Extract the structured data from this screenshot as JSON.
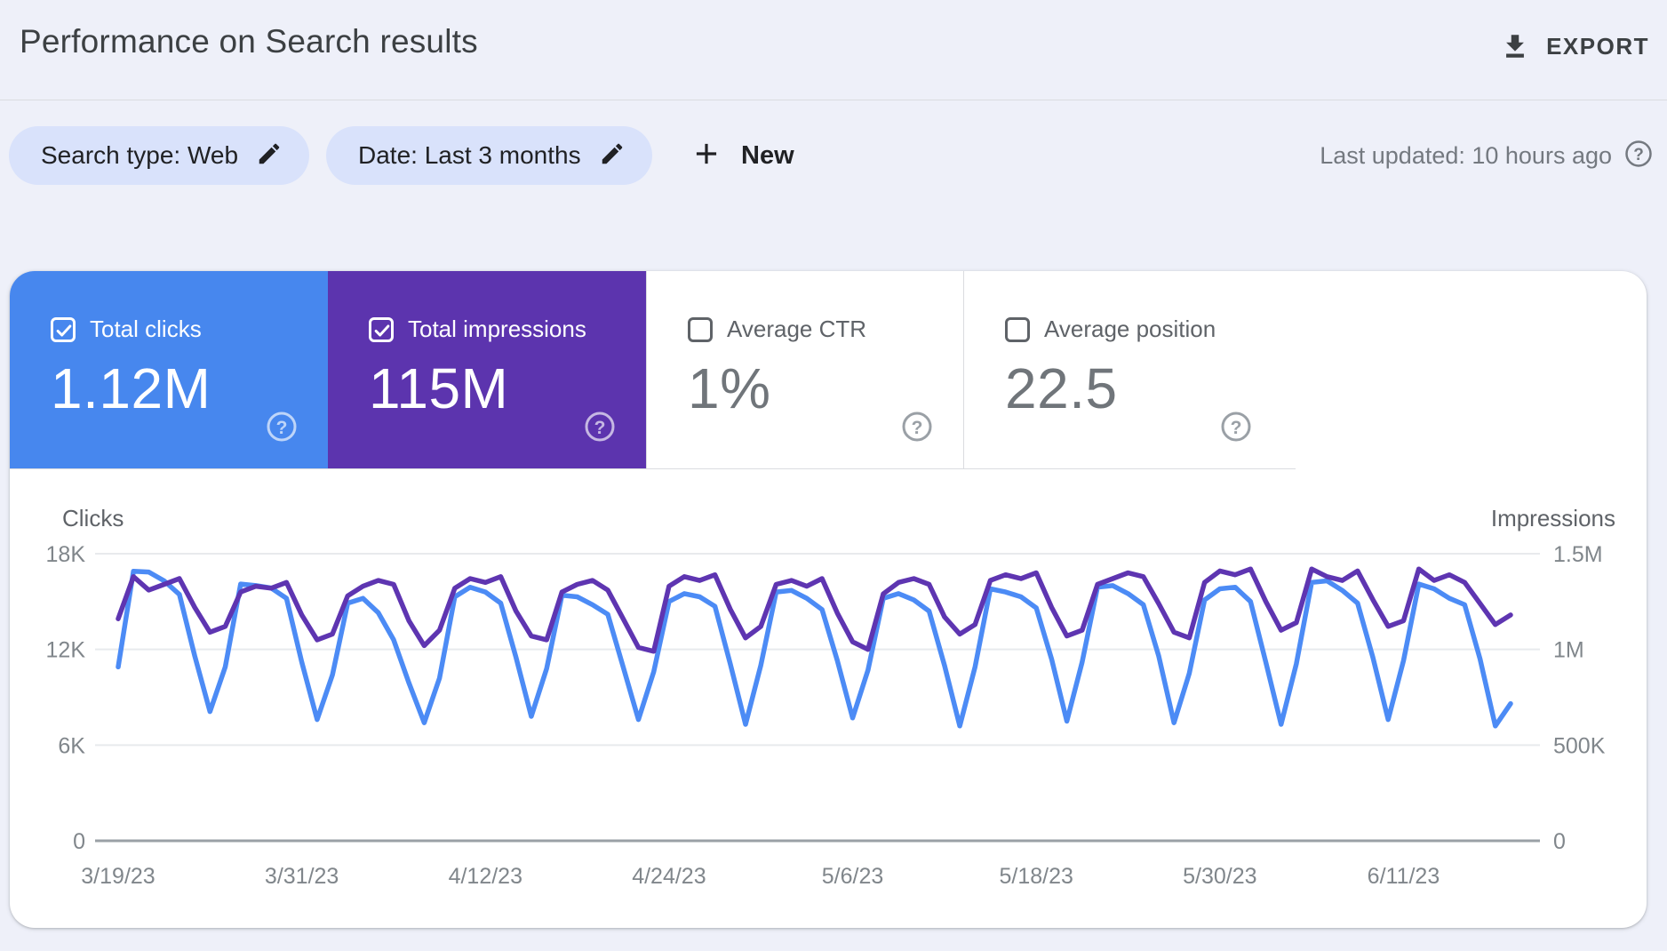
{
  "page": {
    "background": "#eef0f9"
  },
  "header": {
    "title": "Performance on Search results",
    "export_label": "EXPORT"
  },
  "filters": {
    "search_type_chip": "Search type: Web",
    "date_chip": "Date: Last 3 months",
    "new_label": "New",
    "last_updated": "Last updated: 10 hours ago"
  },
  "metrics": [
    {
      "label": "Total clicks",
      "value": "1.12M",
      "selected": true,
      "color": "#4787ee",
      "text_color": "#ffffff",
      "label_color": "#ffffff",
      "help_color": "rgba(255,255,255,0.65)"
    },
    {
      "label": "Total impressions",
      "value": "115M",
      "selected": true,
      "color": "#5c34ae",
      "text_color": "#ffffff",
      "label_color": "#ffffff",
      "help_color": "rgba(255,255,255,0.65)"
    },
    {
      "label": "Average CTR",
      "value": "1%",
      "selected": false,
      "color": "#ffffff",
      "text_color": "#70757a",
      "label_color": "#5f6368",
      "help_color": "#9aa0a6"
    },
    {
      "label": "Average position",
      "value": "22.5",
      "selected": false,
      "color": "#ffffff",
      "text_color": "#70757a",
      "label_color": "#5f6368",
      "help_color": "#9aa0a6"
    }
  ],
  "chart_data": {
    "type": "line",
    "title": "Performance on Search results",
    "grid": true,
    "legend_position": "none",
    "left_axis": {
      "title": "Clicks",
      "max": 18000,
      "ticks": [
        {
          "value": 18000,
          "label": "18K"
        },
        {
          "value": 12000,
          "label": "12K"
        },
        {
          "value": 6000,
          "label": "6K"
        },
        {
          "value": 0,
          "label": "0"
        }
      ]
    },
    "right_axis": {
      "title": "Impressions",
      "max": 1500000,
      "ticks": [
        {
          "value": 1500000,
          "label": "1.5M"
        },
        {
          "value": 1000000,
          "label": "1M"
        },
        {
          "value": 500000,
          "label": "500K"
        },
        {
          "value": 0,
          "label": "0"
        }
      ]
    },
    "x_ticks": [
      {
        "index": 0,
        "label": "3/19/23"
      },
      {
        "index": 12,
        "label": "3/31/23"
      },
      {
        "index": 24,
        "label": "4/12/23"
      },
      {
        "index": 36,
        "label": "4/24/23"
      },
      {
        "index": 48,
        "label": "5/6/23"
      },
      {
        "index": 60,
        "label": "5/18/23"
      },
      {
        "index": 72,
        "label": "5/30/23"
      },
      {
        "index": 84,
        "label": "6/11/23"
      }
    ],
    "series": [
      {
        "name": "Total clicks",
        "axis": "left",
        "color": "#4c8bf5",
        "values": [
          10900,
          16900,
          16850,
          16300,
          15450,
          11600,
          8100,
          10900,
          16100,
          16000,
          15850,
          15200,
          11200,
          7600,
          10400,
          14900,
          15200,
          14300,
          12600,
          9900,
          7400,
          10200,
          15300,
          15900,
          15600,
          14900,
          11500,
          7800,
          10800,
          15400,
          15300,
          14800,
          14200,
          10900,
          7600,
          10600,
          15000,
          15500,
          15300,
          14700,
          11100,
          7300,
          11000,
          15600,
          15700,
          15200,
          14500,
          11300,
          7700,
          10700,
          15200,
          15500,
          15100,
          14400,
          11000,
          7200,
          10900,
          15800,
          15600,
          15300,
          14600,
          11400,
          7500,
          11200,
          15900,
          16000,
          15500,
          14800,
          11600,
          7400,
          10500,
          15100,
          15800,
          15900,
          15000,
          11200,
          7300,
          11100,
          16200,
          16300,
          15700,
          14900,
          11500,
          7600,
          11300,
          16100,
          15800,
          15200,
          14800,
          11400,
          7200,
          8600
        ]
      },
      {
        "name": "Total impressions",
        "axis": "right",
        "color": "#5e35b1",
        "values": [
          1160000,
          1380000,
          1310000,
          1340000,
          1370000,
          1220000,
          1090000,
          1120000,
          1300000,
          1330000,
          1320000,
          1350000,
          1180000,
          1050000,
          1080000,
          1280000,
          1330000,
          1360000,
          1340000,
          1150000,
          1020000,
          1100000,
          1320000,
          1370000,
          1350000,
          1380000,
          1200000,
          1070000,
          1050000,
          1300000,
          1340000,
          1360000,
          1310000,
          1160000,
          1010000,
          990000,
          1330000,
          1380000,
          1360000,
          1390000,
          1210000,
          1060000,
          1120000,
          1340000,
          1360000,
          1330000,
          1370000,
          1190000,
          1040000,
          1000000,
          1290000,
          1350000,
          1370000,
          1340000,
          1170000,
          1080000,
          1130000,
          1360000,
          1390000,
          1370000,
          1400000,
          1220000,
          1070000,
          1100000,
          1340000,
          1370000,
          1400000,
          1380000,
          1240000,
          1090000,
          1060000,
          1350000,
          1410000,
          1390000,
          1420000,
          1250000,
          1100000,
          1140000,
          1420000,
          1380000,
          1360000,
          1410000,
          1260000,
          1120000,
          1150000,
          1420000,
          1360000,
          1390000,
          1350000,
          1240000,
          1130000,
          1180000
        ]
      }
    ]
  }
}
